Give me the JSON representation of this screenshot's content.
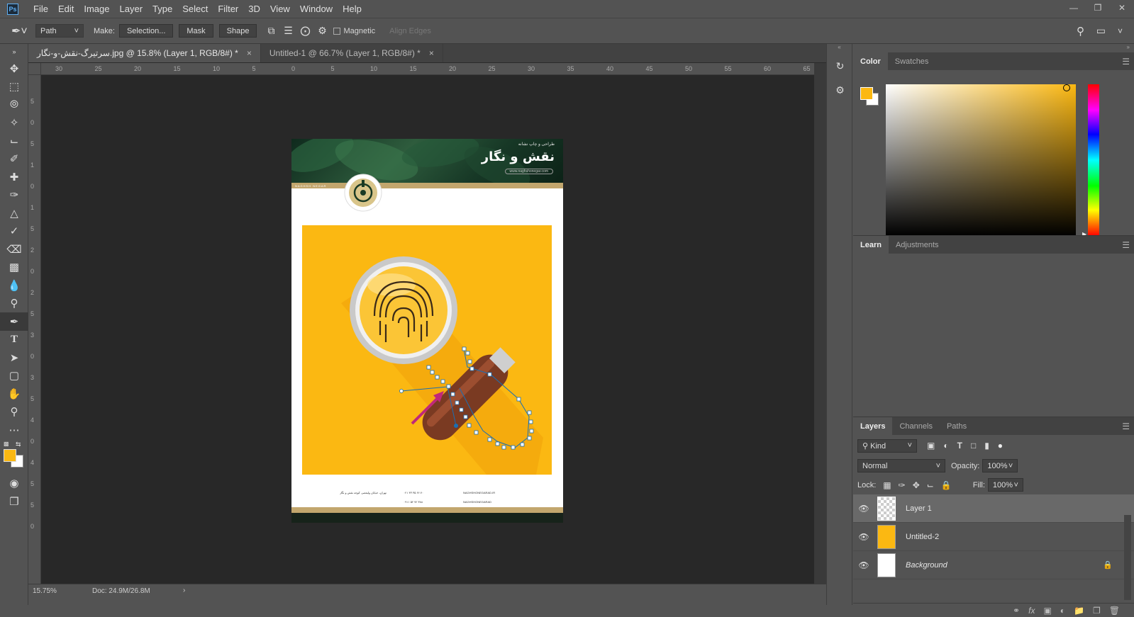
{
  "menu": {
    "logo": "Ps",
    "items": [
      "File",
      "Edit",
      "Image",
      "Layer",
      "Type",
      "Select",
      "Filter",
      "3D",
      "View",
      "Window",
      "Help"
    ]
  },
  "options": {
    "mode_value": "Path",
    "make_label": "Make:",
    "selection_btn": "Selection...",
    "mask_btn": "Mask",
    "shape_btn": "Shape",
    "magnetic_label": "Magnetic",
    "align_edges_label": "Align Edges"
  },
  "tabs": [
    {
      "label": "سرتیرگ-نقش-و-نگار.jpg @ 15.8% (Layer 1, RGB/8#) *",
      "close": "×"
    },
    {
      "label": "Untitled-1 @ 66.7% (Layer 1, RGB/8#) *",
      "close": "×"
    }
  ],
  "ruler": {
    "h_labels": [
      "30",
      "25",
      "20",
      "15",
      "10",
      "5",
      "0",
      "5",
      "10",
      "15",
      "20",
      "25",
      "30",
      "35",
      "40",
      "45",
      "50",
      "55",
      "60",
      "65"
    ],
    "v_labels": [
      "5",
      "0",
      "5",
      "1",
      "0",
      "1",
      "5",
      "2",
      "0",
      "2",
      "5",
      "3",
      "0",
      "3",
      "5",
      "4",
      "0",
      "4",
      "5",
      "5",
      "0"
    ]
  },
  "status": {
    "zoom": "15.75%",
    "doc": "Doc: 24.9M/26.8M",
    "arrow": "›"
  },
  "document": {
    "title": "نقش و نگار",
    "subtitle": "طراحی و چاپ نشانه",
    "tagline": "www.naghshonegar.com",
    "logo_text": "NAGHSH NEGAR",
    "footer_phone1": "۰۲۱ ۳۳ ۴۵ ۶۶ ۷۰",
    "footer_phone2": "۰۹۱۱ ۵۲ ۷۲ ۳۸۸",
    "footer_web1": "NAGHSHONEGARAD.IR",
    "footer_web2": "NAGHSHONEGARAD",
    "footer_addr": "تهران، خیابان ولیعصر، کوچه نقش و نگار"
  },
  "panels": {
    "color_tabs": [
      "Color",
      "Swatches"
    ],
    "learn_tabs": [
      "Learn",
      "Adjustments"
    ],
    "layers_tabs": [
      "Layers",
      "Channels",
      "Paths"
    ],
    "kind_label": "Kind",
    "blend_mode": "Normal",
    "opacity_label": "Opacity:",
    "opacity_value": "100%",
    "lock_label": "Lock:",
    "fill_label": "Fill:",
    "fill_value": "100%",
    "layers": [
      {
        "name": "Layer 1"
      },
      {
        "name": "Untitled-2"
      },
      {
        "name": "Background"
      }
    ]
  },
  "colors": {
    "foreground": "#fbb812",
    "background": "#ffffff",
    "accent_path": "#1a6fb3"
  }
}
